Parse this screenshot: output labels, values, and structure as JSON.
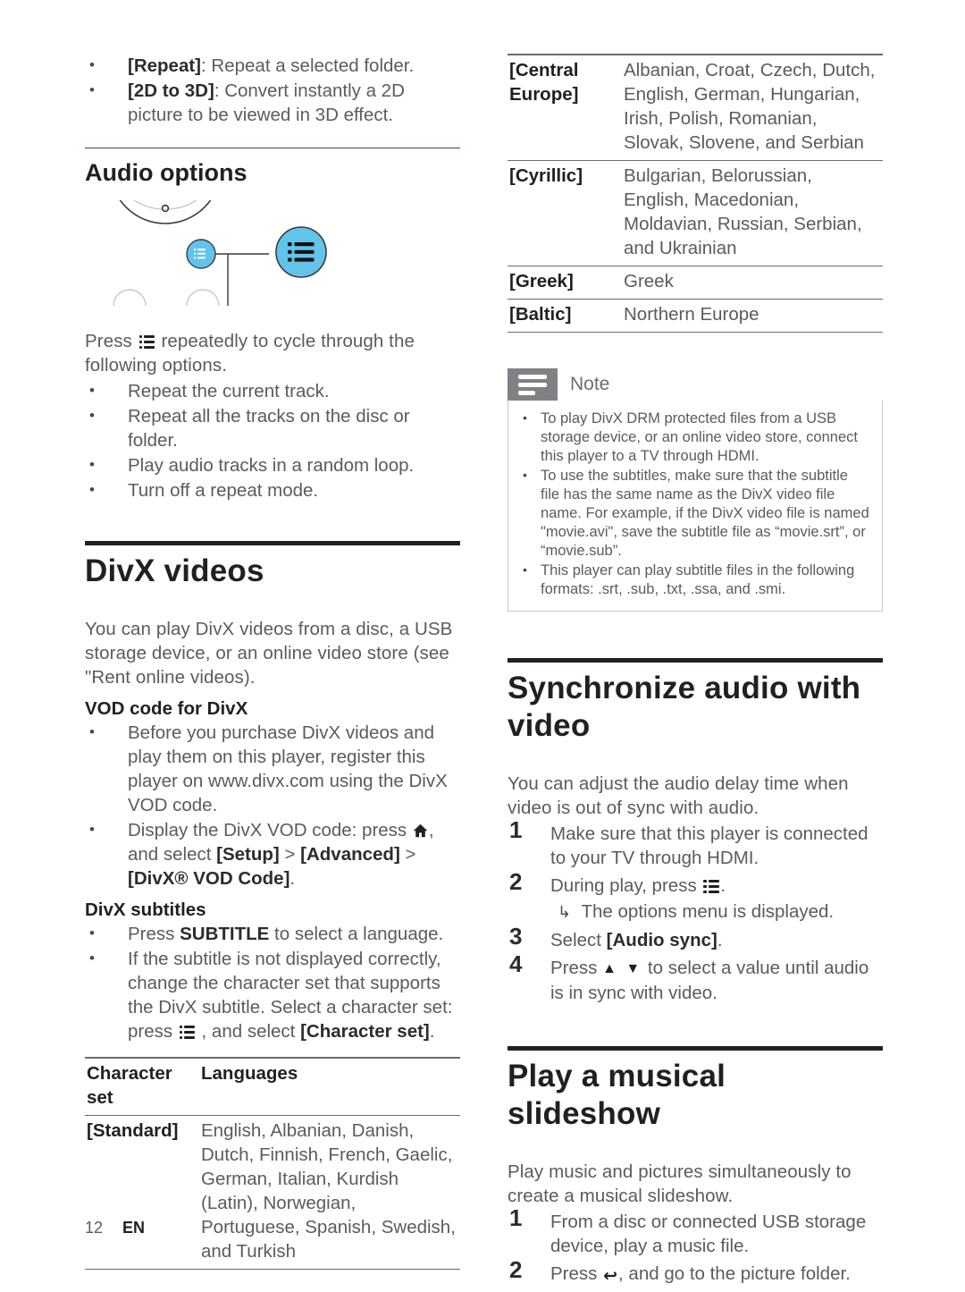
{
  "page": {
    "number": "12",
    "language": "EN"
  },
  "left_column": {
    "top_bullets": [
      {
        "label": "[Repeat]",
        "text": ": Repeat a selected folder."
      },
      {
        "label": "[2D to 3D]",
        "text": ": Convert instantly a 2D picture to be viewed in 3D effect."
      }
    ],
    "audio_options": {
      "heading": "Audio options",
      "figure_name": "remote-control-options-button-callout",
      "intro_pre": "Press ",
      "intro_post": " repeatedly to cycle through the following options.",
      "bullets": [
        "Repeat the current track.",
        "Repeat all the tracks on the disc or folder.",
        "Play audio tracks in a random loop.",
        "Turn off a repeat mode."
      ]
    },
    "divx": {
      "heading": "DivX videos",
      "intro": "You can play DivX videos from a disc, a USB storage device, or an online video store (see \"Rent online videos).",
      "vod": {
        "heading": "VOD code for DivX",
        "bullet1": "Before you purchase DivX videos and play them on this player, register this player on www.divx.com using the DivX VOD code.",
        "bullet2_a": "Display the DivX VOD code: press ",
        "bullet2_b": ", and select ",
        "bullet2_setup": "[Setup]",
        "bullet2_gt1": " > ",
        "bullet2_advanced": "[Advanced]",
        "bullet2_gt2": " > ",
        "bullet2_divx": "[DivX® VOD Code]",
        "bullet2_end": "."
      },
      "subtitles": {
        "heading": "DivX subtitles",
        "b1_pre": "Press ",
        "b1_bold": "SUBTITLE",
        "b1_post": " to select a language.",
        "b2_pre": "If the subtitle is not displayed correctly, change the character set that supports the DivX subtitle. Select a character set: press ",
        "b2_mid": " , and select ",
        "b2_bold": "[Character set]",
        "b2_end": "."
      }
    },
    "charset_table": {
      "headers": [
        "Character set",
        "Languages"
      ],
      "rows": [
        {
          "set": "[Standard]",
          "languages": "English, Albanian, Danish, Dutch, Finnish, French, Gaelic, German, Italian, Kurdish (Latin), Norwegian, Portuguese, Spanish, Swedish, and Turkish"
        }
      ]
    }
  },
  "right_column": {
    "charset_table_cont": {
      "rows": [
        {
          "set": "[Central Europe]",
          "languages": "Albanian, Croat, Czech, Dutch, English, German, Hungarian, Irish, Polish, Romanian, Slovak, Slovene, and Serbian"
        },
        {
          "set": "[Cyrillic]",
          "languages": "Bulgarian, Belorussian, English, Macedonian, Moldavian, Russian, Serbian, and Ukrainian"
        },
        {
          "set": "[Greek]",
          "languages": "Greek"
        },
        {
          "set": "[Baltic]",
          "languages": "Northern Europe"
        }
      ]
    },
    "note": {
      "title": "Note",
      "icon": "note-lines-icon",
      "items": [
        "To play DivX DRM protected files from a USB storage device, or an online video store, connect this player to a TV through HDMI.",
        "To use the subtitles, make sure that the subtitle file has the same name as the DivX video file name. For example, if the DivX video file is named \"movie.avi\", save the subtitle file as “movie.srt”, or “movie.sub”.",
        "This player can play subtitle files in the following formats: .srt, .sub, .txt, .ssa, and .smi."
      ]
    },
    "sync": {
      "heading": "Synchronize audio with video",
      "intro": "You can adjust the audio delay time when video is out of sync with audio.",
      "step1": "Make sure that this player is connected to your TV through HDMI.",
      "step2_pre": "During play, press ",
      "step2_post": ".",
      "step2_result": "The options menu is displayed.",
      "step3_pre": "Select ",
      "step3_bold": "[Audio sync]",
      "step3_post": ".",
      "step4_pre": "Press ",
      "step4_arrows": "▲ ▼",
      "step4_post": " to select a value until audio is in sync with video."
    },
    "slideshow": {
      "heading": "Play a musical slideshow",
      "intro": "Play music and pictures simultaneously to create a musical slideshow.",
      "step1": "From a disc or connected USB storage device, play a music file.",
      "step2_pre": "Press ",
      "step2_post": ", and go to the picture folder."
    }
  },
  "colors": {
    "accent_blue": "#62C4E8",
    "rule_dark": "#231f20",
    "rule_maroon": "#5b3a3f",
    "note_gray": "#808085",
    "body_text": "#5b5b5f"
  }
}
